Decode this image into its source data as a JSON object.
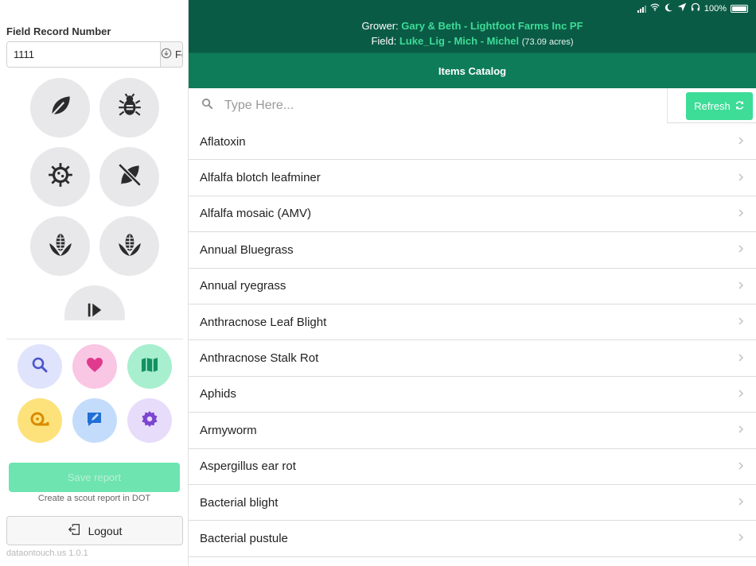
{
  "sidebar": {
    "field_record_label": "Field Record Number",
    "field_record_value": "1111",
    "fetch_label": "Fetch",
    "category_icons": [
      "leaf-icon",
      "bug-icon",
      "virus-icon",
      "leaf-slash-icon",
      "corn-icon",
      "corn-icon",
      "play-icon"
    ],
    "tool_buttons": [
      {
        "icon": "search-icon",
        "color": "#dfe3fb"
      },
      {
        "icon": "heart-icon",
        "color": "#f9c6e4"
      },
      {
        "icon": "map-icon",
        "color": "#a7efcf"
      },
      {
        "icon": "tape-measure-icon",
        "color": "#fde27b"
      },
      {
        "icon": "edit-icon",
        "color": "#c4dcfb"
      },
      {
        "icon": "gear-icon",
        "color": "#e8dcfb"
      }
    ],
    "save_label": "Save report",
    "save_caption": "Create a scout report in DOT",
    "logout_label": "Logout",
    "version": "dataontouch.us 1.0.1"
  },
  "status_bar": {
    "battery": "100%"
  },
  "header": {
    "grower_prefix": "Grower:",
    "grower_name": "Gary & Beth - Lightfoot Farms Inc PF",
    "field_prefix": "Field:",
    "field_name": "Luke_Lig - Mich - Michel",
    "field_acres": "(73.09 acres)",
    "title": "Items Catalog"
  },
  "search": {
    "placeholder": "Type Here...",
    "value": "",
    "refresh_label": "Refresh"
  },
  "catalog": {
    "items": [
      "Aflatoxin",
      "Alfalfa blotch leafminer",
      "Alfalfa mosaic (AMV)",
      "Annual Bluegrass",
      "Annual ryegrass",
      "Anthracnose Leaf Blight",
      "Anthracnose Stalk Rot",
      "Aphids",
      "Armyworm",
      "Aspergillus ear rot",
      "Bacterial blight",
      "Bacterial pustule"
    ]
  },
  "colors": {
    "header_dark": "#0a5b45",
    "header_bar": "#0e7c58",
    "accent": "#3ddc97",
    "save_button": "#6ee4b0"
  }
}
